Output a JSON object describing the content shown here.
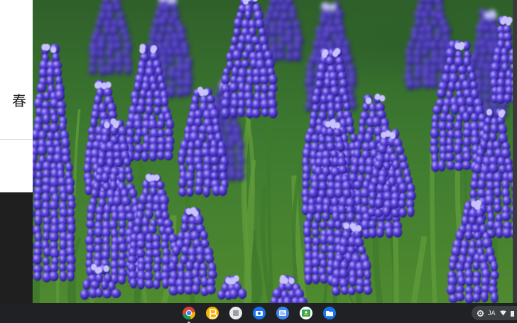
{
  "background_page": {
    "heading": "春"
  },
  "shelf": {
    "apps": [
      {
        "name": "chrome-icon",
        "color": "#4285f4"
      },
      {
        "name": "app-yellow-icon",
        "color": "#f6b400"
      },
      {
        "name": "files-gray-icon",
        "color": "#e8eaed"
      },
      {
        "name": "camera-icon",
        "color": "#1a73e8"
      },
      {
        "name": "app-blue-icon",
        "color": "#4285f4"
      },
      {
        "name": "classroom-icon",
        "color": "#34a853"
      },
      {
        "name": "files-icon",
        "color": "#1a73e8"
      }
    ],
    "tray": {
      "input_method": "JA"
    }
  }
}
